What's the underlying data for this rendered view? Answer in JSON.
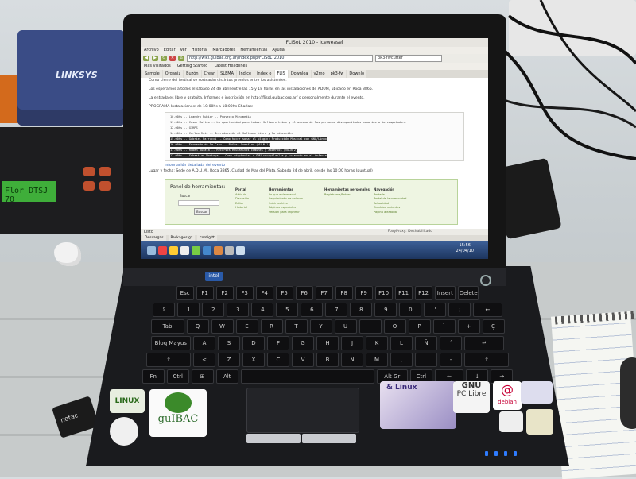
{
  "scene": {
    "router_brand": "LINKSYS",
    "equipment_display": "Flor  DTSJ 70",
    "laptop_brand_badge": "intel",
    "usb_label": "netac"
  },
  "browser": {
    "window_title": "FLISoL 2010 - Iceweasel",
    "menu": [
      "Archivo",
      "Editar",
      "Ver",
      "Historial",
      "Marcadores",
      "Herramientas",
      "Ayuda"
    ],
    "url": "http://wiki.gulbac.org.ar/index.php/FLISoL_2010",
    "search_value": "pk3-fwcutter",
    "bookmarks": [
      "Más visitados",
      "Getting Started",
      "Latest Headlines"
    ],
    "tabs": [
      "Sample",
      "Organiz",
      "Buzón",
      "Crear",
      "SLEMA",
      "Índice",
      "Index o",
      "FLIS",
      "Downloa",
      "v2mo",
      "pk3-fw",
      "Downlo"
    ],
    "active_tab": "FLIS",
    "status_text": "Listo",
    "proxy_text": "FoxyProxy: Deshabilitado",
    "download_items": [
      "Descargas",
      "Packages.gz",
      "config.tt"
    ]
  },
  "page": {
    "paragraphs": [
      "Como cierre del festival se sortearán distintos premios entre los asistentes.",
      "Los esperamos a todos el sábado 24 de abril entre las 15 y 18 horas en las instalaciones de ADUM, ubicado en Roca 3865.",
      "La entrada es libre y gratuita. Informes e inscripción en http://flisol.gulbac.org.ar/ o personalmente durante el evento.",
      "PROGRAMA Instalaciones: de 10:00hs a 18:00hs Charlas:"
    ],
    "schedule": [
      {
        "text": "10.00hs -- Leandro Rubiar -- Proyecto Minumedia",
        "highlight": false
      },
      {
        "text": "11.00hs -- Cesar Matteo -- La oportunidad para todos: Software Libre y el acceso de las personas discapacitadas usuarias a la computadora",
        "highlight": false
      },
      {
        "text": "12.00hs -- GIRPS",
        "highlight": false
      },
      {
        "text": "14.00hs -- Carlos Ruiz -- Introducción al Software Libre y la educación",
        "highlight": false
      },
      {
        "text": "15.00hs -- Gabriel Parrucci -- Como hacer sonar el plugin: Producción Musical con GNU/Linux",
        "highlight": true
      },
      {
        "text": "16.00hs -- Fernando de la Cruz -- Buffer Overflow (VULN 1)",
        "highlight": true
      },
      {
        "text": "17.00hs -- Ruben Burata -- Recursos educativos comunes y abiertos (VULN 2)",
        "highlight": true
      },
      {
        "text": "17.00hs -- Sebastian Montoya -- Como adaptarlas a GNU recopilarlas y un mundo en el infante",
        "highlight": true
      }
    ],
    "info_link": "Información detallada del evento",
    "location": "Lugar y fecha: Sede de A.D.U.M., Roca 3865, Ciudad de Mar del Plata. Sábado 24 de abril, desde las 10:00 horas (puntual)"
  },
  "tools_panel": {
    "title": "Panel de herramientas:",
    "search_label": "Buscar",
    "search_button": "Buscar",
    "columns": [
      {
        "heading": "Portal",
        "items": [
          "Artículo",
          "Discusión",
          "Editar",
          "Historial"
        ]
      },
      {
        "heading": "Herramientas",
        "items": [
          "Lo que enlaza aquí",
          "Seguimiento de enlaces",
          "Subir archivo",
          "Páginas especiales",
          "Versión para imprimir"
        ]
      },
      {
        "heading": "Herramientas personales",
        "items": [
          "Registrarse/Entrar"
        ]
      },
      {
        "heading": "Navegación",
        "items": [
          "Portada",
          "Portal de la comunidad",
          "Actualidad",
          "Cambios recientes",
          "Página aleatoria"
        ]
      }
    ]
  },
  "taskbar": {
    "clock_time": "15:56",
    "clock_date": "24/04/10"
  },
  "stickers": {
    "linux_badge": "LINUX",
    "gulbac": "guIBAC",
    "gnu_linux": "& Linux",
    "gnu_pc_libre_top": "GNU",
    "gnu_pc_libre_bottom": "PC Libre",
    "debian": "debian"
  },
  "keys": {
    "row1": [
      "Esc",
      "F1",
      "F2",
      "F3",
      "F4",
      "F5",
      "F6",
      "F7",
      "F8",
      "F9",
      "F10",
      "F11",
      "F12",
      "Insert",
      "Delete"
    ],
    "row2": [
      "º",
      "1",
      "2",
      "3",
      "4",
      "5",
      "6",
      "7",
      "8",
      "9",
      "0",
      "'",
      "¡",
      "←"
    ],
    "row3": [
      "Tab",
      "Q",
      "W",
      "E",
      "R",
      "T",
      "Y",
      "U",
      "I",
      "O",
      "P",
      "`",
      "+",
      "Ç"
    ],
    "row4": [
      "Bloq Mayus",
      "A",
      "S",
      "D",
      "F",
      "G",
      "H",
      "J",
      "K",
      "L",
      "Ñ",
      "´",
      "↵"
    ],
    "row5": [
      "⇧",
      "<",
      "Z",
      "X",
      "C",
      "V",
      "B",
      "N",
      "M",
      ",",
      ".",
      "-",
      "⇧"
    ],
    "row6": [
      "Fn",
      "Ctrl",
      "⊞",
      "Alt",
      "",
      "Alt Gr",
      "Ctrl",
      "←",
      "↓",
      "→"
    ]
  }
}
